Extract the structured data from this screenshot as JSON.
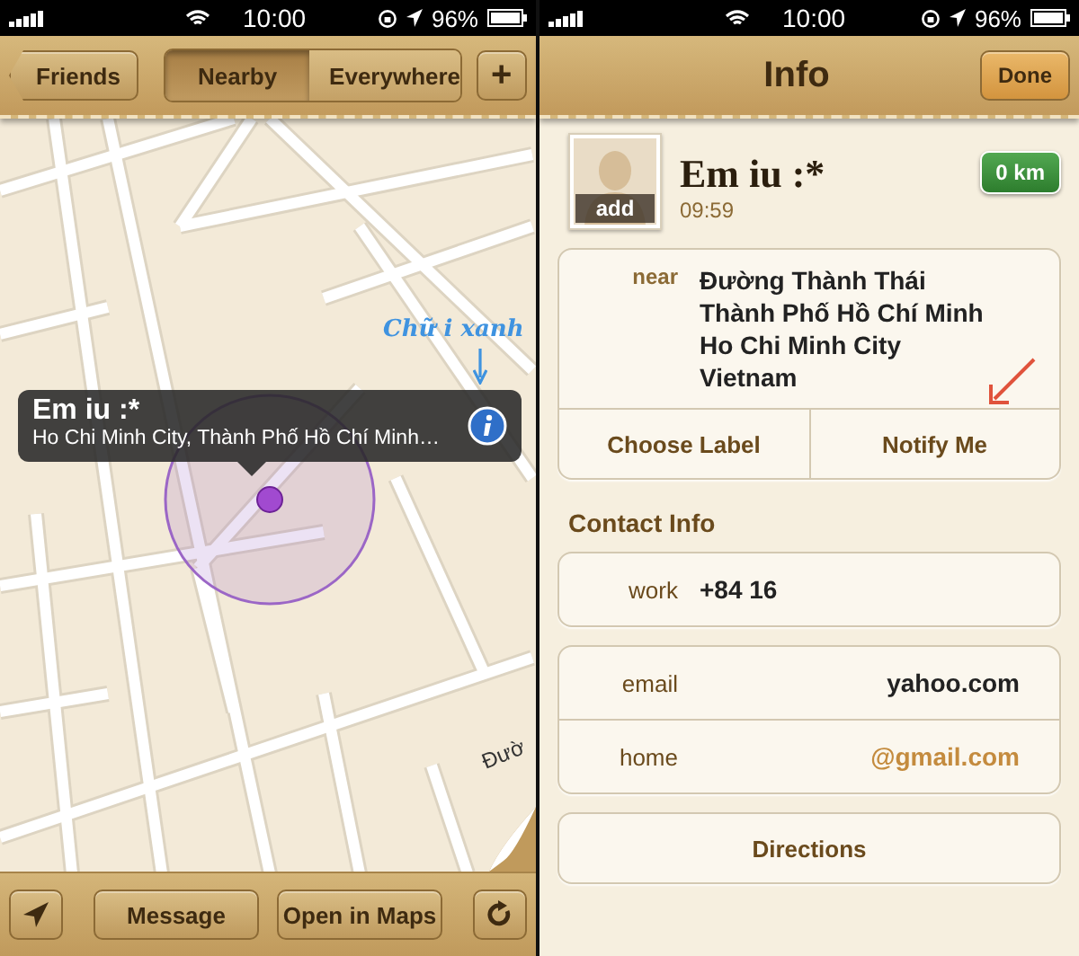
{
  "left_screen": {
    "status_bar": {
      "time": "10:00",
      "battery": "96%"
    },
    "nav_bar": {
      "back_button": "Friends",
      "segments": [
        {
          "label": "Nearby",
          "selected": true
        },
        {
          "label": "Everywhere",
          "selected": false
        }
      ],
      "add_button": "+"
    },
    "map": {
      "street_label": "Đườ",
      "callout": {
        "title": "Em iu :*",
        "subtitle": "Ho Chi Minh City, Thành Phố Hồ Chí Minh…"
      },
      "annotation": "Chữ i xanh"
    },
    "toolbar": {
      "buttons": [
        "Message",
        "Open in Maps"
      ]
    }
  },
  "right_screen": {
    "status_bar": {
      "time": "10:00",
      "battery": "96%"
    },
    "nav_bar": {
      "title": "Info",
      "done_button": "Done"
    },
    "contact": {
      "avatar_label": "add",
      "name": "Em iu :*",
      "time": "09:59",
      "distance": "0 km"
    },
    "location": {
      "label": "near",
      "lines": [
        "Đường Thành Thái",
        "Thành Phố Hồ Chí Minh",
        "Ho Chi Minh City",
        "Vietnam"
      ],
      "actions": [
        "Choose Label",
        "Notify Me"
      ]
    },
    "section_title": "Contact Info",
    "phone": {
      "label": "work",
      "value": "+84 16"
    },
    "emails": [
      {
        "label": "email",
        "value": "yahoo.com",
        "kind": "plain"
      },
      {
        "label": "home",
        "value": "@gmail.com",
        "kind": "link"
      }
    ],
    "directions_button": "Directions"
  }
}
